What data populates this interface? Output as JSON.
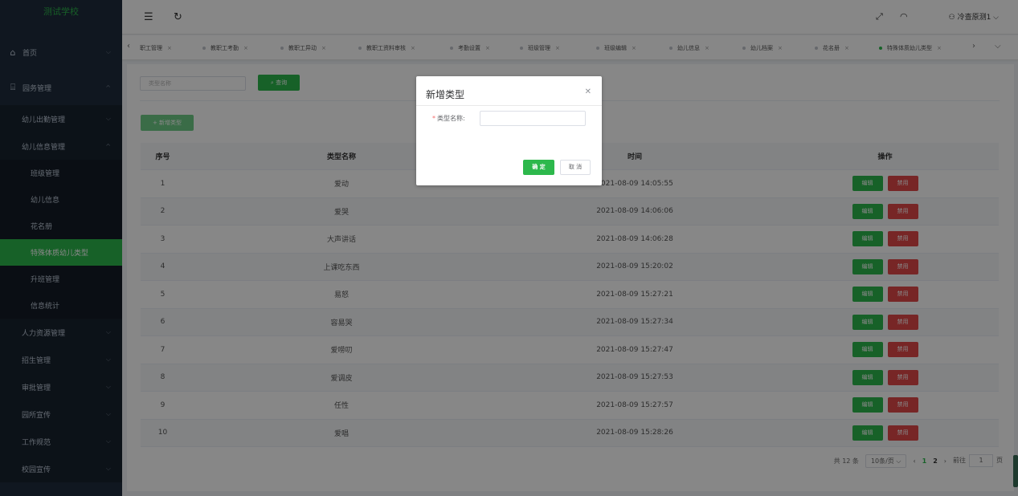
{
  "logo": "测试学校",
  "sidebar": {
    "home": "首页",
    "garden": "园务管理",
    "attendance": "幼儿出勤管理",
    "info": "幼儿信息管理",
    "leaves": [
      "班级管理",
      "幼儿信息",
      "花名册",
      "特殊体质幼儿类型",
      "升班管理",
      "信息统计"
    ],
    "groups": [
      "人力资源管理",
      "招生管理",
      "审批管理",
      "园所宣传",
      "工作规范",
      "校园宣传"
    ]
  },
  "header": {
    "user": "冷查原测1"
  },
  "tags": [
    "职工管理",
    "教职工考勤",
    "教职工异动",
    "教职工资料审核",
    "考勤设置",
    "班级管理",
    "班级编辑",
    "幼儿信息",
    "幼儿档案",
    "花名册",
    "特殊体质幼儿类型"
  ],
  "search": {
    "placeholder": "类型名称",
    "button": "查询"
  },
  "add_button": "+ 新增类型",
  "table": {
    "headers": {
      "idx": "序号",
      "name": "类型名称",
      "time": "时间",
      "ops": "操作"
    },
    "rows": [
      {
        "idx": "1",
        "name": "爱动",
        "time": "2021-08-09 14:05:55"
      },
      {
        "idx": "2",
        "name": "爱哭",
        "time": "2021-08-09 14:06:06"
      },
      {
        "idx": "3",
        "name": "大声讲话",
        "time": "2021-08-09 14:06:28"
      },
      {
        "idx": "4",
        "name": "上课吃东西",
        "time": "2021-08-09 15:20:02"
      },
      {
        "idx": "5",
        "name": "易怒",
        "time": "2021-08-09 15:27:21"
      },
      {
        "idx": "6",
        "name": "容易哭",
        "time": "2021-08-09 15:27:34"
      },
      {
        "idx": "7",
        "name": "爱唠叨",
        "time": "2021-08-09 15:27:47"
      },
      {
        "idx": "8",
        "name": "爱调皮",
        "time": "2021-08-09 15:27:53"
      },
      {
        "idx": "9",
        "name": "任性",
        "time": "2021-08-09 15:27:57"
      },
      {
        "idx": "10",
        "name": "爱唱",
        "time": "2021-08-09 15:28:26"
      }
    ],
    "edit": "编辑",
    "disable": "禁用"
  },
  "pager": {
    "total": "共 12 条",
    "size": "10条/页",
    "p1": "1",
    "p2": "2",
    "goto": "前往",
    "goto_val": "1",
    "page": "页"
  },
  "dialog": {
    "title": "新增类型",
    "label": "类型名称:",
    "ok": "确 定",
    "cancel": "取 消"
  },
  "colors": {
    "primary": "#2db84c",
    "danger": "#e04848",
    "sidebar": "#1f2d3d"
  }
}
